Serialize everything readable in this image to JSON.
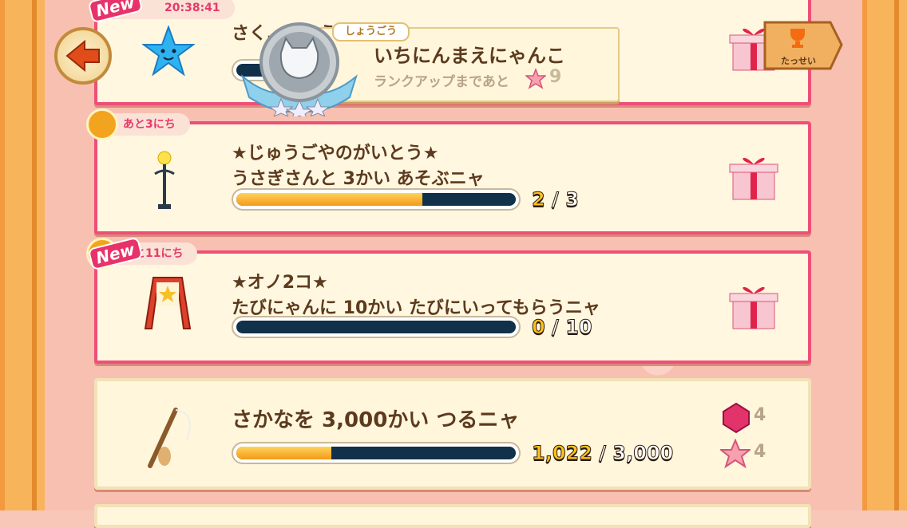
{
  "header": {
    "timer": "20:38:41",
    "partial_title": "さく…しょうかくするニャ",
    "badge_label": "しょうごう",
    "rank_title": "いちにんまえにゃんこ",
    "rank_up_label": "ランクアップまであと",
    "rank_up_count": "9",
    "trophy_label": "たっせい"
  },
  "new_badge": "New",
  "missions": [
    {
      "days_left": "あと3にち",
      "title_line1": "★じゅうごやのがいとう★",
      "title_line2": "うさぎさんと 3かい あそぶニャ",
      "progress_current": "2",
      "progress_sep": " / ",
      "progress_total": "3",
      "progress_fraction": 0.667
    },
    {
      "days_left": "あと11にち",
      "title_line1": "★オノ2コ★",
      "title_line2": "たびにゃんに 10かい たびにいってもらうニャ",
      "progress_current": "0",
      "progress_sep": " / ",
      "progress_total": "10",
      "progress_fraction": 0
    },
    {
      "title_line1": "さかなを 3,000かい つるニャ",
      "progress_current": "1,022",
      "progress_sep": " / ",
      "progress_total": "3,000",
      "progress_fraction": 0.341,
      "reward_gem_count": "4",
      "reward_star_count": "4"
    }
  ],
  "colors": {
    "accent_pink": "#ee4f78",
    "bar_fill": "#f39a18",
    "bar_track": "#11304a"
  }
}
